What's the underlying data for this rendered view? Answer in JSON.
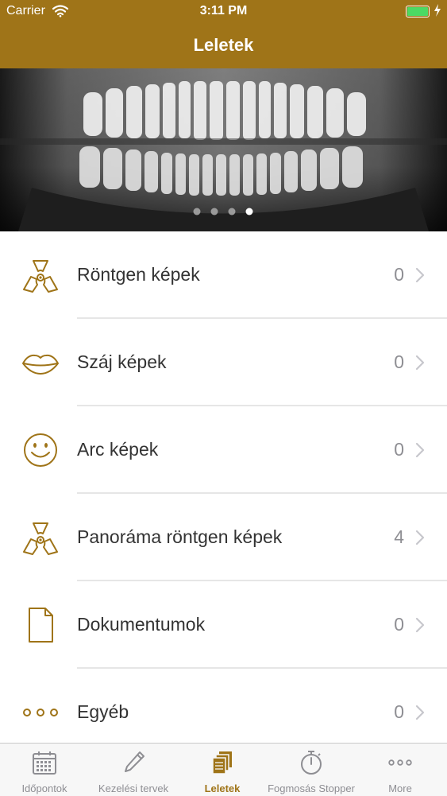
{
  "status_bar": {
    "carrier": "Carrier",
    "time": "3:11 PM",
    "battery_level": 1.0
  },
  "nav": {
    "title": "Leletek"
  },
  "banner": {
    "page_count": 4,
    "current_page": 4
  },
  "list": [
    {
      "label": "Röntgen képek",
      "count": "0",
      "icon": "radiation-icon"
    },
    {
      "label": "Száj képek",
      "count": "0",
      "icon": "lips-icon"
    },
    {
      "label": "Arc képek",
      "count": "0",
      "icon": "smiley-icon"
    },
    {
      "label": "Panoráma röntgen képek",
      "count": "4",
      "icon": "radiation-icon"
    },
    {
      "label": "Dokumentumok",
      "count": "0",
      "icon": "document-icon"
    },
    {
      "label": "Egyéb",
      "count": "0",
      "icon": "dots-icon"
    }
  ],
  "tabs": [
    {
      "label": "Időpontok",
      "icon": "calendar-icon"
    },
    {
      "label": "Kezelési tervek",
      "icon": "pencil-icon"
    },
    {
      "label": "Leletek",
      "icon": "documents-stack-icon",
      "active": true
    },
    {
      "label": "Fogmosás Stopper",
      "icon": "stopwatch-icon"
    },
    {
      "label": "More",
      "icon": "more-dots-icon"
    }
  ],
  "colors": {
    "accent": "#9f7418",
    "battery": "#4cd964",
    "count": "#8e8e93",
    "text": "#333333"
  }
}
